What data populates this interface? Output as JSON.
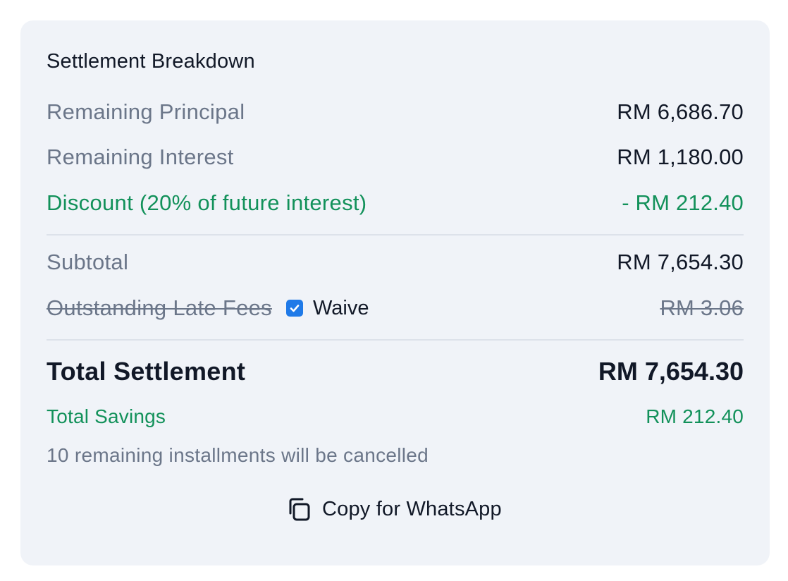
{
  "card": {
    "title": "Settlement Breakdown",
    "rows": {
      "principal": {
        "label": "Remaining Principal",
        "value": "RM 6,686.70"
      },
      "interest": {
        "label": "Remaining Interest",
        "value": "RM 1,180.00"
      },
      "discount": {
        "label": "Discount (20% of future interest)",
        "value": "- RM 212.40"
      },
      "subtotal": {
        "label": "Subtotal",
        "value": "RM 7,654.30"
      },
      "late_fees": {
        "label": "Outstanding Late Fees",
        "waive_label": "Waive",
        "waive_checked": true,
        "value": "RM 3.06"
      }
    },
    "total": {
      "label": "Total Settlement",
      "value": "RM 7,654.30"
    },
    "savings": {
      "label": "Total Savings",
      "value": "RM 212.40"
    },
    "note": "10 remaining installments will be cancelled",
    "copy_button": {
      "label": "Copy for WhatsApp",
      "icon": "copy-icon"
    }
  },
  "colors": {
    "card_bg": "#f0f3f8",
    "text_primary": "#111827",
    "text_muted": "#6b7689",
    "accent_green": "#12915a",
    "checkbox_blue": "#1f7ae8"
  }
}
